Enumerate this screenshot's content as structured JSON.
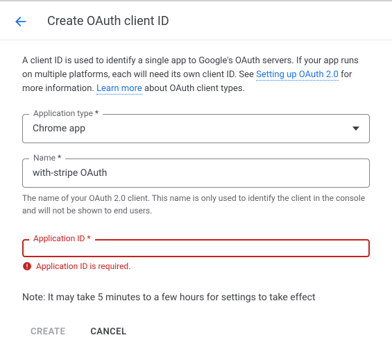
{
  "header": {
    "title": "Create OAuth client ID"
  },
  "intro": {
    "part1": "A client ID is used to identify a single app to Google's OAuth servers. If your app runs on multiple platforms, each will need its own client ID. See ",
    "link1": "Setting up OAuth 2.0",
    "part2": " for more information. ",
    "link2": "Learn more",
    "part3": " about OAuth client types."
  },
  "fields": {
    "app_type": {
      "label": "Application type ",
      "value": "Chrome app"
    },
    "name": {
      "label": "Name ",
      "value": "with-stripe OAuth",
      "help": "The name of your OAuth 2.0 client. This name is only used to identify the client in the console and will not be shown to end users."
    },
    "app_id": {
      "label": "Application ID ",
      "value": "",
      "error": "Application ID is required."
    }
  },
  "note": "Note: It may take 5 minutes to a few hours for settings to take effect",
  "buttons": {
    "create": "Create",
    "cancel": "Cancel"
  },
  "asterisk": "*"
}
